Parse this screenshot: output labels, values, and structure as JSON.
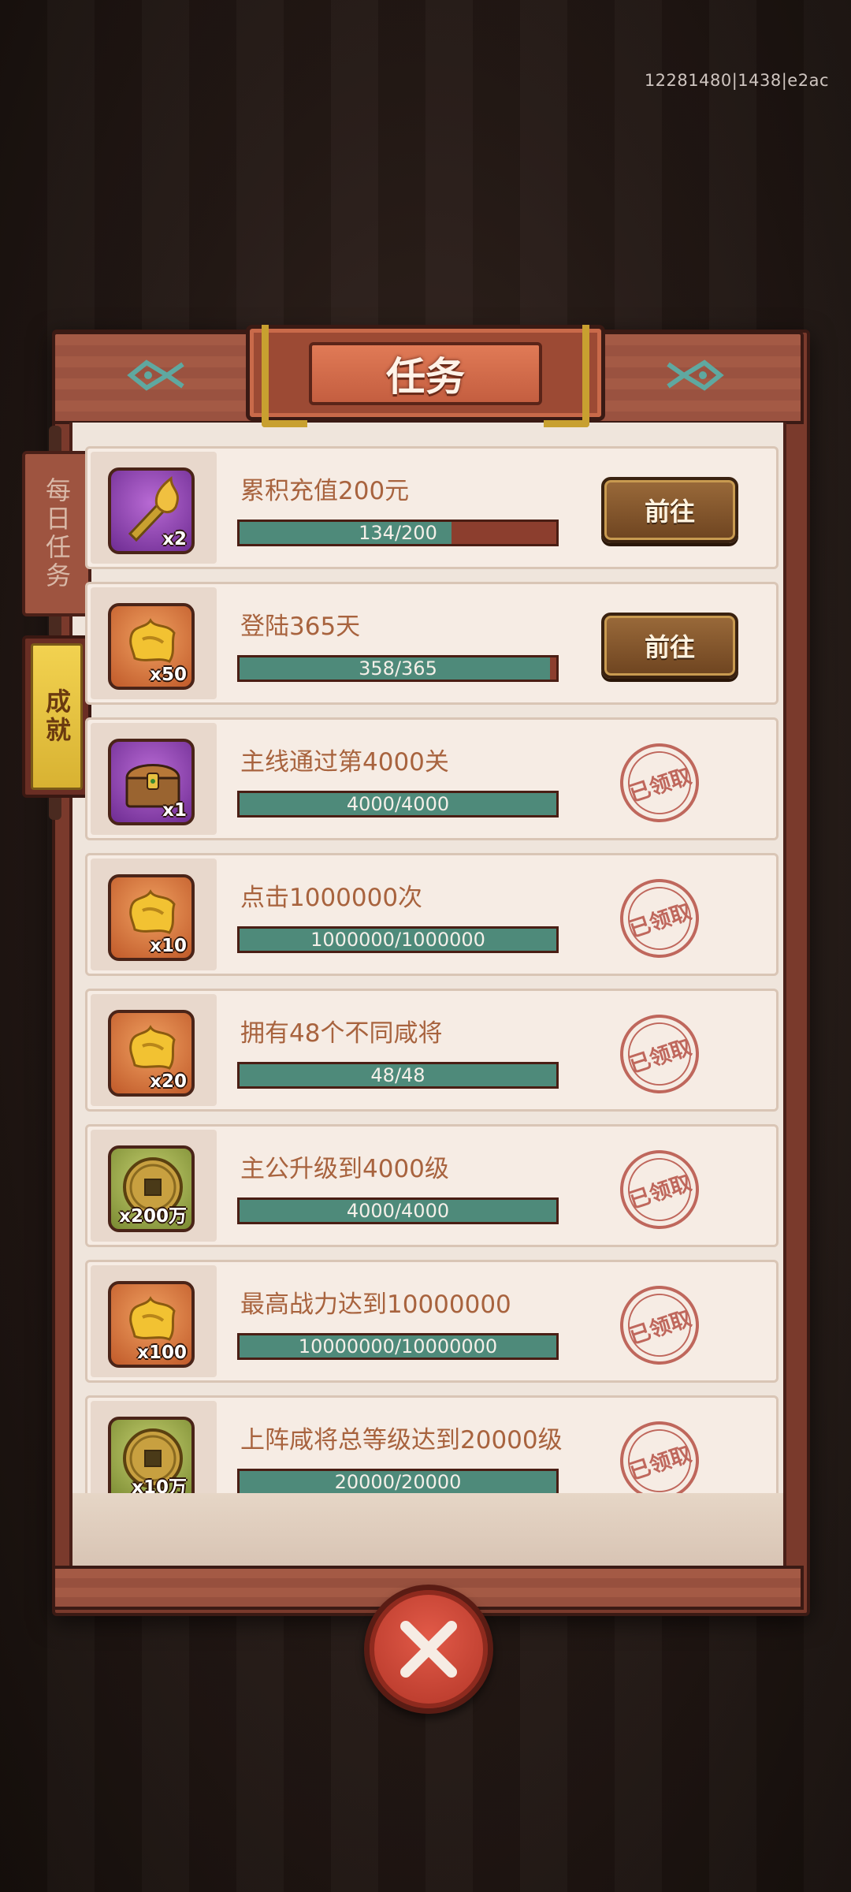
{
  "build_id": "12281480|1438|e2ac",
  "title": "任务",
  "tabs": [
    {
      "label": "每日任务",
      "active": false
    },
    {
      "label": "成就",
      "active": true
    }
  ],
  "colors": {
    "progress_fill": "#4e8a7a",
    "progress_track": "#8c3e2e",
    "title_text": "#a8633e",
    "stamp": "#b8554a"
  },
  "tasks": [
    {
      "title": "累积充值200元",
      "progress_text": "134/200",
      "current": 134,
      "target": 200,
      "reward_icon": "golden-torch-icon",
      "icon_bg": "purple",
      "reward_qty": "x2",
      "status": "go",
      "action_label": "前往"
    },
    {
      "title": "登陆365天",
      "progress_text": "358/365",
      "current": 358,
      "target": 365,
      "reward_icon": "gold-ingot-icon",
      "icon_bg": "orange",
      "reward_qty": "x50",
      "status": "go",
      "action_label": "前往"
    },
    {
      "title": "主线通过第4000关",
      "progress_text": "4000/4000",
      "current": 4000,
      "target": 4000,
      "reward_icon": "treasure-chest-icon",
      "icon_bg": "purple",
      "reward_qty": "x1",
      "status": "claimed",
      "action_label": "已领取"
    },
    {
      "title": "点击1000000次",
      "progress_text": "1000000/1000000",
      "current": 1000000,
      "target": 1000000,
      "reward_icon": "gold-ingot-icon",
      "icon_bg": "orange",
      "reward_qty": "x10",
      "status": "claimed",
      "action_label": "已领取"
    },
    {
      "title": "拥有48个不同咸将",
      "progress_text": "48/48",
      "current": 48,
      "target": 48,
      "reward_icon": "gold-ingot-icon",
      "icon_bg": "orange",
      "reward_qty": "x20",
      "status": "claimed",
      "action_label": "已领取"
    },
    {
      "title": "主公升级到4000级",
      "progress_text": "4000/4000",
      "current": 4000,
      "target": 4000,
      "reward_icon": "copper-coin-icon",
      "icon_bg": "green",
      "reward_qty": "x200万",
      "status": "claimed",
      "action_label": "已领取"
    },
    {
      "title": "最高战力达到10000000",
      "progress_text": "10000000/10000000",
      "current": 10000000,
      "target": 10000000,
      "reward_icon": "gold-ingot-icon",
      "icon_bg": "orange",
      "reward_qty": "x100",
      "status": "claimed",
      "action_label": "已领取"
    },
    {
      "title": "上阵咸将总等级达到20000级",
      "progress_text": "20000/20000",
      "current": 20000,
      "target": 20000,
      "reward_icon": "copper-coin-icon",
      "icon_bg": "green",
      "reward_qty": "x10万",
      "status": "claimed",
      "action_label": "已领取"
    }
  ],
  "close_icon": "close-icon"
}
